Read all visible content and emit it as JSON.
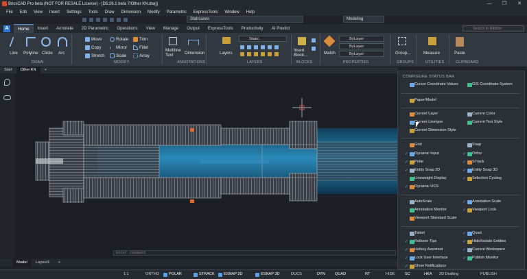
{
  "window": {
    "title": "BricsCAD Pro beta (NOT FOR RESALE License) - [D5:26.1 beta 7/Other KN.dwg]",
    "controls": [
      "—",
      "❐",
      "✕"
    ]
  },
  "menu": [
    "File",
    "Edit",
    "View",
    "Insert",
    "Settings",
    "Tools",
    "Draw",
    "Dimension",
    "Modify",
    "Parametric",
    "ExpressTools",
    "Window",
    "Help"
  ],
  "workspace": {
    "layer_dd": "Staircases",
    "mode_dd": "Modeling"
  },
  "ribbon_tabs": [
    "Home",
    "Insert",
    "Annotate",
    "2D Parametric",
    "Operations",
    "View",
    "Manage",
    "Output",
    "ExpressTools",
    "Productivity",
    "AI Predict"
  ],
  "search_placeholder": "Search in Ribbon",
  "ribbon": {
    "draw": [
      "Line",
      "Polyline",
      "Circle",
      "Arc"
    ],
    "modify": [
      "Move",
      "Rotate",
      "Trim",
      "Copy",
      "Mirror",
      "Fillet",
      "Stretch",
      "Scale",
      "Array"
    ],
    "annotations": [
      "Multiline Text",
      "Dimension"
    ],
    "layers": [
      "Layers",
      "Stairc"
    ],
    "blocks": [
      "Insert Block..."
    ],
    "properties": [
      "Match",
      "ByLayer",
      "ByLayer",
      "ByLayer"
    ],
    "groups": [
      "Group..."
    ],
    "utilities": [
      "Measure"
    ],
    "clipboard": [
      "Paste"
    ],
    "panels": [
      "DRAW",
      "MODIFY",
      "ANNOTATIONS",
      "LAYERS",
      "BLOCKS",
      "PROPERTIES",
      "GROUPS",
      "UTILITIES",
      "CLIPBOARD"
    ]
  },
  "doc_tabs": [
    "Start",
    "Other KN",
    "+"
  ],
  "command_prompt": "Enter command",
  "layout_tabs": [
    "Model",
    "Layout1",
    "+"
  ],
  "status": {
    "scale": "1:1",
    "items": [
      "ORTHO",
      "POLAR",
      "STRACK",
      "ESNAP 2D",
      "ESNAP 3D",
      "DUCS",
      "DYN",
      "QUAD",
      "RT",
      "HIDE",
      "SC",
      "HKA",
      "2D Drafting",
      "PUBLISH"
    ]
  },
  "config_panel": {
    "title": "CONFIGURE STATUS BAR",
    "items": [
      {
        "label": "Cursor Coordinate Values",
        "checked": false
      },
      {
        "label": "GIS Coordinate System",
        "checked": false
      },
      {
        "label": "Paper/Model",
        "checked": false
      },
      {
        "label": "Current Layer",
        "checked": false
      },
      {
        "label": "Current Color",
        "checked": false
      },
      {
        "label": "Current Linetype",
        "checked": false
      },
      {
        "label": "Current Text Style",
        "checked": false
      },
      {
        "label": "Current Dimension Style",
        "checked": false
      },
      {
        "label": "Grid",
        "checked": false
      },
      {
        "label": "Snap",
        "checked": false
      },
      {
        "label": "Dynamic Input",
        "checked": true
      },
      {
        "label": "Ortho",
        "checked": true
      },
      {
        "label": "Polar",
        "checked": true
      },
      {
        "label": "STrack",
        "checked": true
      },
      {
        "label": "Entity Snap 2D",
        "checked": true
      },
      {
        "label": "Entity Snap 3D",
        "checked": true
      },
      {
        "label": "Lineweight Display",
        "checked": false
      },
      {
        "label": "Selection Cycling",
        "checked": true
      },
      {
        "label": "Dynamic UCS",
        "checked": true
      },
      {
        "label": "AutoScale",
        "checked": false
      },
      {
        "label": "Annotation Scale",
        "checked": true
      },
      {
        "label": "Annotation Monitor",
        "checked": false
      },
      {
        "label": "Viewport Lock",
        "checked": true
      },
      {
        "label": "Viewport Standard Scale",
        "checked": false
      },
      {
        "label": "Tablet",
        "checked": false
      },
      {
        "label": "Quad",
        "checked": true
      },
      {
        "label": "Rollover Tips",
        "checked": true
      },
      {
        "label": "Hide/Isolate Entities",
        "checked": true
      },
      {
        "label": "Hotkey Assistant",
        "checked": true
      },
      {
        "label": "Current Workspace",
        "checked": true
      },
      {
        "label": "Lock User Interface",
        "checked": true
      },
      {
        "label": "Publish Monitor",
        "checked": true
      },
      {
        "label": "Show Notifications",
        "checked": true
      }
    ]
  },
  "colors": {
    "accent": "#2d7ad6",
    "canvas": "#1c2026",
    "model_fill": "#1d6a90",
    "stairs": "#9aa0a8"
  }
}
